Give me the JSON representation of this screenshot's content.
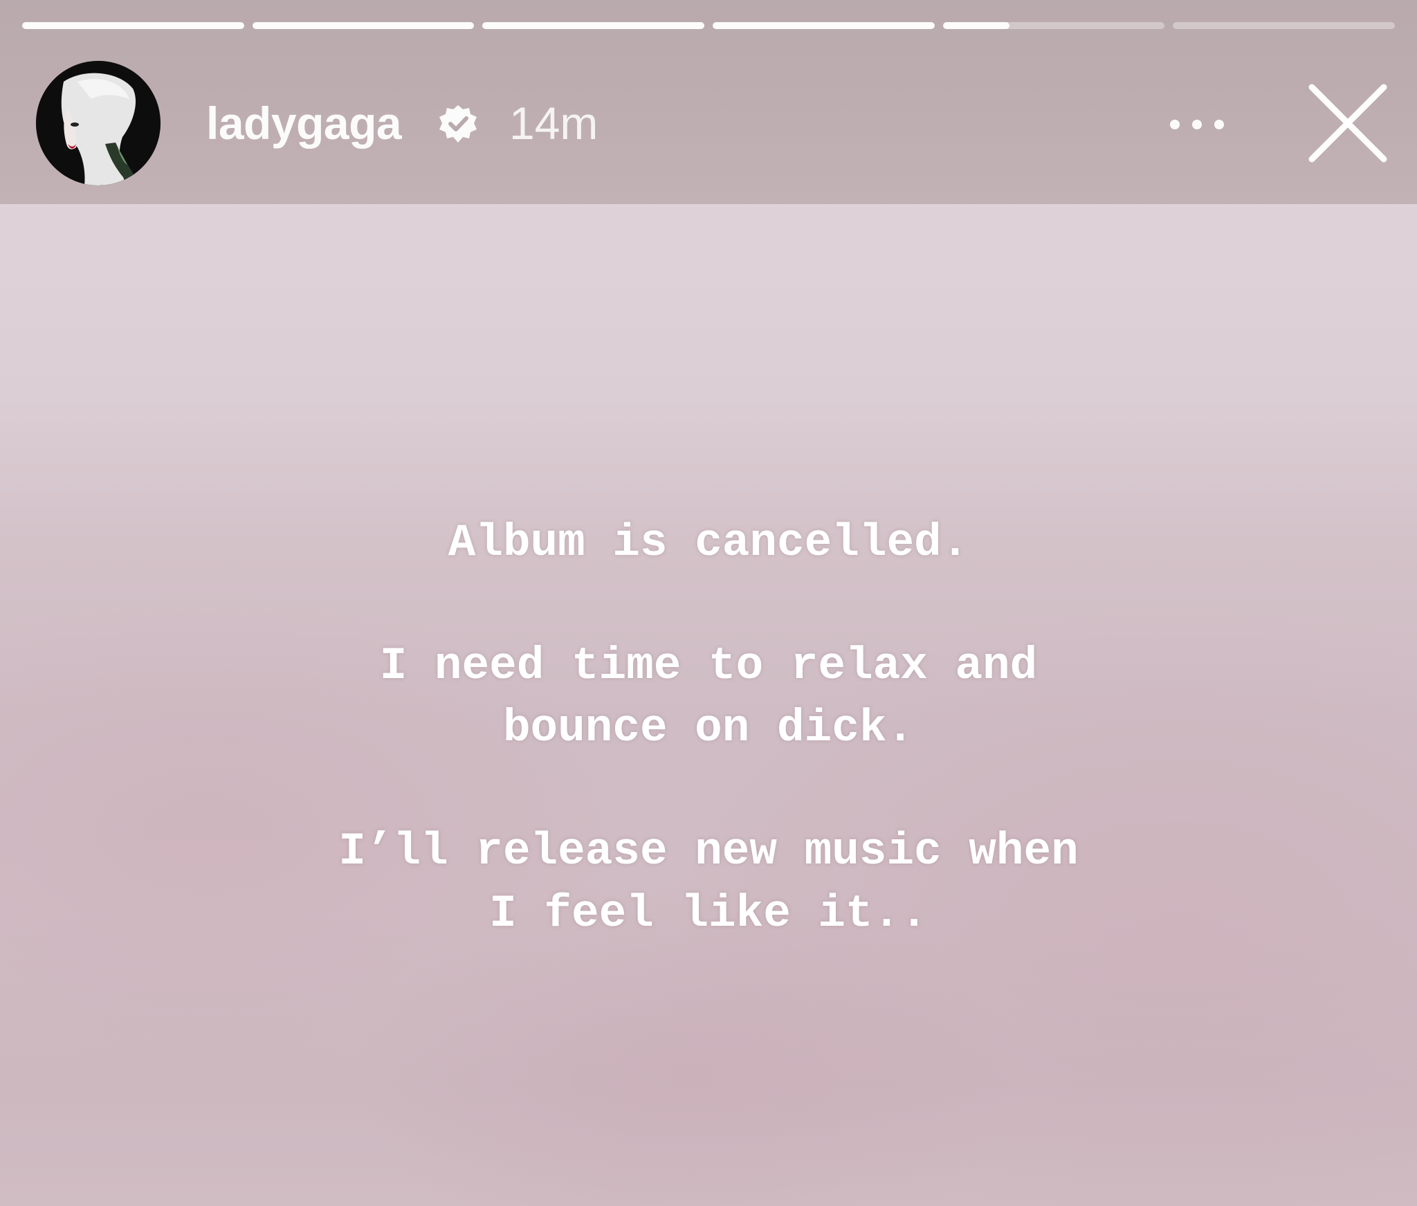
{
  "story": {
    "progress_segments": [
      1,
      1,
      1,
      1,
      0.3,
      0
    ],
    "username": "ladygaga",
    "timestamp": "14m",
    "caption_paragraphs": [
      [
        "Album is cancelled."
      ],
      [
        "I need time to relax and",
        "bounce on dick."
      ],
      [
        "I’ll release new music when",
        "I feel like it.."
      ]
    ]
  },
  "icons": {
    "avatar": "profile-photo",
    "verified": "verified-badge-icon",
    "more": "more-options-icon",
    "close": "close-icon"
  },
  "colors": {
    "header": "#bcacb0",
    "background": "#d6c8cd",
    "text": "#ffffff"
  }
}
